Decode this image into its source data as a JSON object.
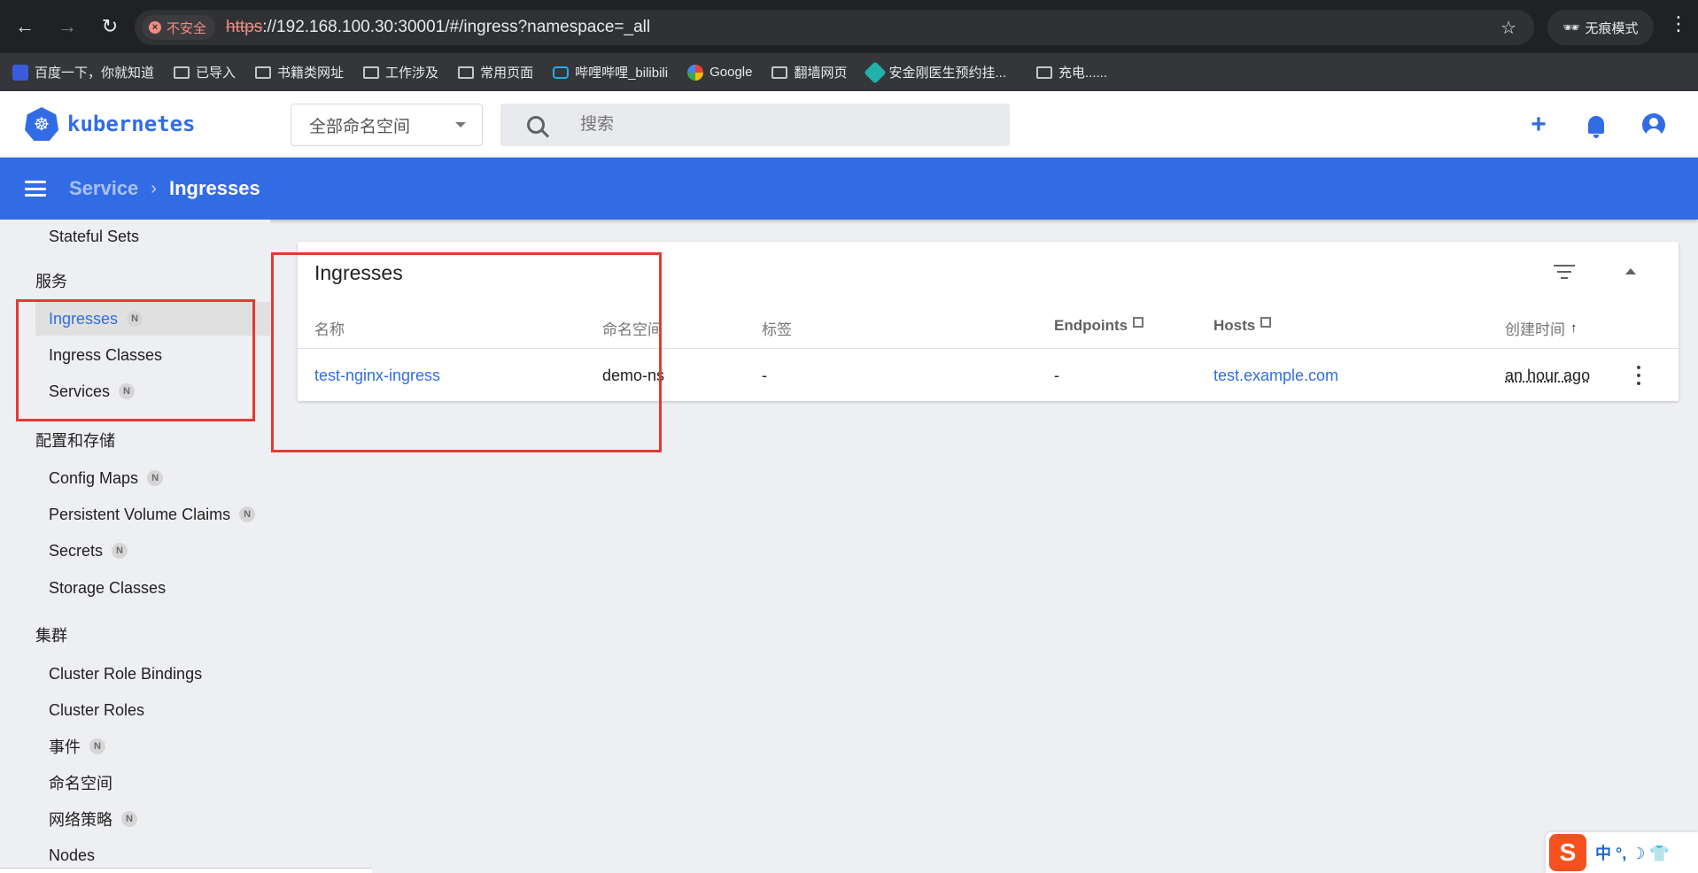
{
  "browser": {
    "security_label": "不安全",
    "url_scheme": "https",
    "url_rest": "://192.168.100.30:30001/#/ingress?namespace=_all",
    "incognito_label": "无痕模式",
    "bookmarks": [
      {
        "label": "百度一下，你就知道",
        "icon": "baidu-icon"
      },
      {
        "label": "已导入",
        "icon": "folder-icon"
      },
      {
        "label": "书籍类网址",
        "icon": "folder-icon"
      },
      {
        "label": "工作涉及",
        "icon": "folder-icon"
      },
      {
        "label": "常用页面",
        "icon": "folder-icon"
      },
      {
        "label": "哔哩哔哩_bilibili",
        "icon": "bilibili-icon"
      },
      {
        "label": "Google",
        "icon": "google-icon"
      },
      {
        "label": "翻墙网页",
        "icon": "folder-icon"
      },
      {
        "label": "安金刚医生预约挂...",
        "icon": "medical-icon"
      },
      {
        "label": "充电......",
        "icon": "folder-icon"
      }
    ]
  },
  "header": {
    "logo_text": "kubernetes",
    "namespace_select": "全部命名空间",
    "search_placeholder": "搜索"
  },
  "toolbar": {
    "breadcrumb_parent": "Service",
    "breadcrumb_current": "Ingresses"
  },
  "sidebar": {
    "top_item": "Stateful Sets",
    "badge": "N",
    "sections": {
      "service": "服务",
      "config": "配置和存储",
      "cluster": "集群"
    },
    "service_items": [
      "Ingresses",
      "Ingress Classes",
      "Services"
    ],
    "config_items": [
      "Config Maps",
      "Persistent Volume Claims",
      "Secrets",
      "Storage Classes"
    ],
    "cluster_items": [
      "Cluster Role Bindings",
      "Cluster Roles",
      "事件",
      "命名空间",
      "网络策略",
      "Nodes"
    ]
  },
  "card": {
    "title": "Ingresses",
    "columns": {
      "name": "名称",
      "namespace": "命名空间",
      "labels": "标签",
      "endpoints": "Endpoints",
      "hosts": "Hosts",
      "created": "创建时间"
    },
    "rows": [
      {
        "name": "test-nginx-ingress",
        "namespace": "demo-ns",
        "labels": "-",
        "endpoints": "-",
        "hosts": "test.example.com",
        "created": "an hour ago"
      }
    ]
  },
  "ime": {
    "logo": "S",
    "text": "中 °, ☽ 👕"
  },
  "colors": {
    "brand": "#326ce5",
    "annotation": "#e53935"
  }
}
